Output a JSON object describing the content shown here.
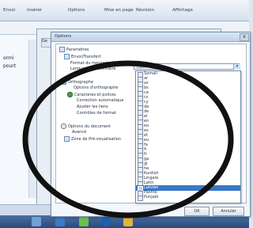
{
  "menubar": {
    "items": [
      "Envoi",
      "Insérer",
      "Options",
      "Mise en page",
      "Révision",
      "Affichage"
    ]
  },
  "left_pane": {
    "lines": [
      "ormi",
      "pourt"
    ]
  },
  "background": {
    "tab_label": "Ge"
  },
  "dialog": {
    "title": "Options",
    "close_label": "x",
    "tree": {
      "root": "Paramètres",
      "items": [
        "Envoi/Transfert",
        "Format du message",
        "Langue du dictionnaire",
        "Orthographe",
        "Options d'orthographe",
        "Caractères et polices",
        "Correction automatique",
        "Ajuster les liens",
        "Contrôles de format",
        "Options du document",
        "Avancé",
        "Zone de Pré-visualisation"
      ]
    },
    "language_field": {
      "value": "Latin"
    },
    "language_options": [
      "Somali",
      "ar",
      "az",
      "bs",
      "ca",
      "cs",
      "cy",
      "da",
      "de",
      "el",
      "en",
      "eo",
      "es",
      "et",
      "eu",
      "fa",
      "fi",
      "fr",
      "ga",
      "gl",
      "he",
      "Kurdish",
      "Lingala",
      "Latin",
      "Latvian",
      "Pashto",
      "Punjabi"
    ],
    "selected_option": "Latvian",
    "buttons": {
      "ok": "OK",
      "cancel": "Annuler"
    }
  }
}
